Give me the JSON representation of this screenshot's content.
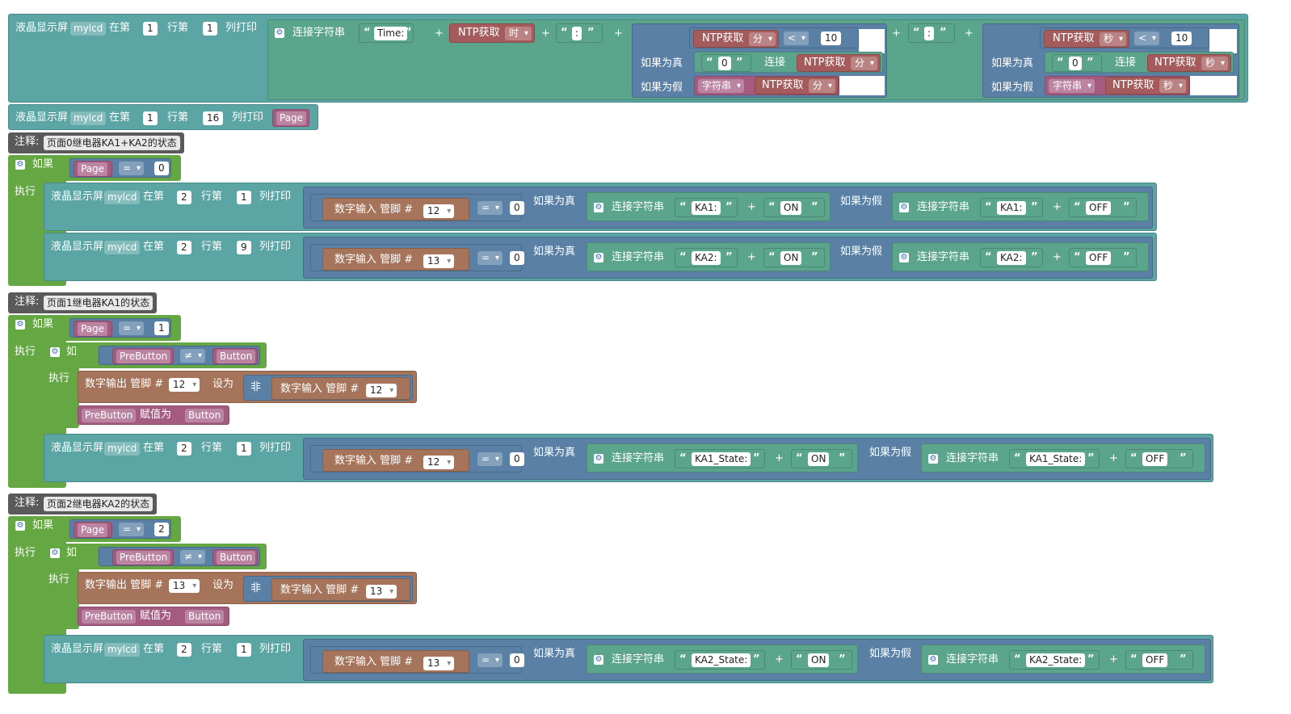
{
  "lcd": {
    "label": "液晶显示屏",
    "var": "mylcd",
    "at": "在第",
    "row": "行第",
    "col": "列打印"
  },
  "join": "连接字符串",
  "ntp": {
    "label": "NTP获取",
    "hour": "时",
    "minute": "分",
    "second": "秒"
  },
  "ternary": {
    "if_true": "如果为真",
    "if_false": "如果为假"
  },
  "concat": "连接",
  "tostring": "字符串",
  "ops": {
    "lt": "<",
    "eq": "=",
    "neq": "≠",
    "plus": "+",
    "not": "非"
  },
  "control": {
    "if": "如果",
    "do": "执行",
    "comment": "注释:"
  },
  "pin_in": "数字输入 管脚 #",
  "pin_out": "数字输出 管脚 #",
  "set_to": "设为",
  "assign": "赋值为",
  "vars": {
    "page": "Page",
    "prebutton": "PreButton",
    "button": "Button"
  },
  "strings": {
    "time": "Time:",
    "colon": ":",
    "zero": "0",
    "on": "ON",
    "off": "OFF",
    "ka1": "KA1:",
    "ka2": "KA2:",
    "ka1state": "KA1_State:",
    "ka2state": "KA2_State:"
  },
  "nums": {
    "one": "1",
    "two": "2",
    "nine": "9",
    "ten": "10",
    "sixteen": "16",
    "zero": "0",
    "twelve": "12",
    "thirteen": "13"
  },
  "comments": {
    "c0": "页面0继电器KA1+KA2的状态",
    "c1": "页面1继电器KA1的状态",
    "c2": "页面2继电器KA2的状态"
  },
  "colors": {
    "lcd": "#5ba5a5",
    "control": "#65a742",
    "join": "#5ba58c",
    "ternary": "#5b80a5",
    "ntp": "#a55b5b",
    "pin": "#a5745b",
    "var": "#a55b80",
    "number": "#5b67a5"
  }
}
